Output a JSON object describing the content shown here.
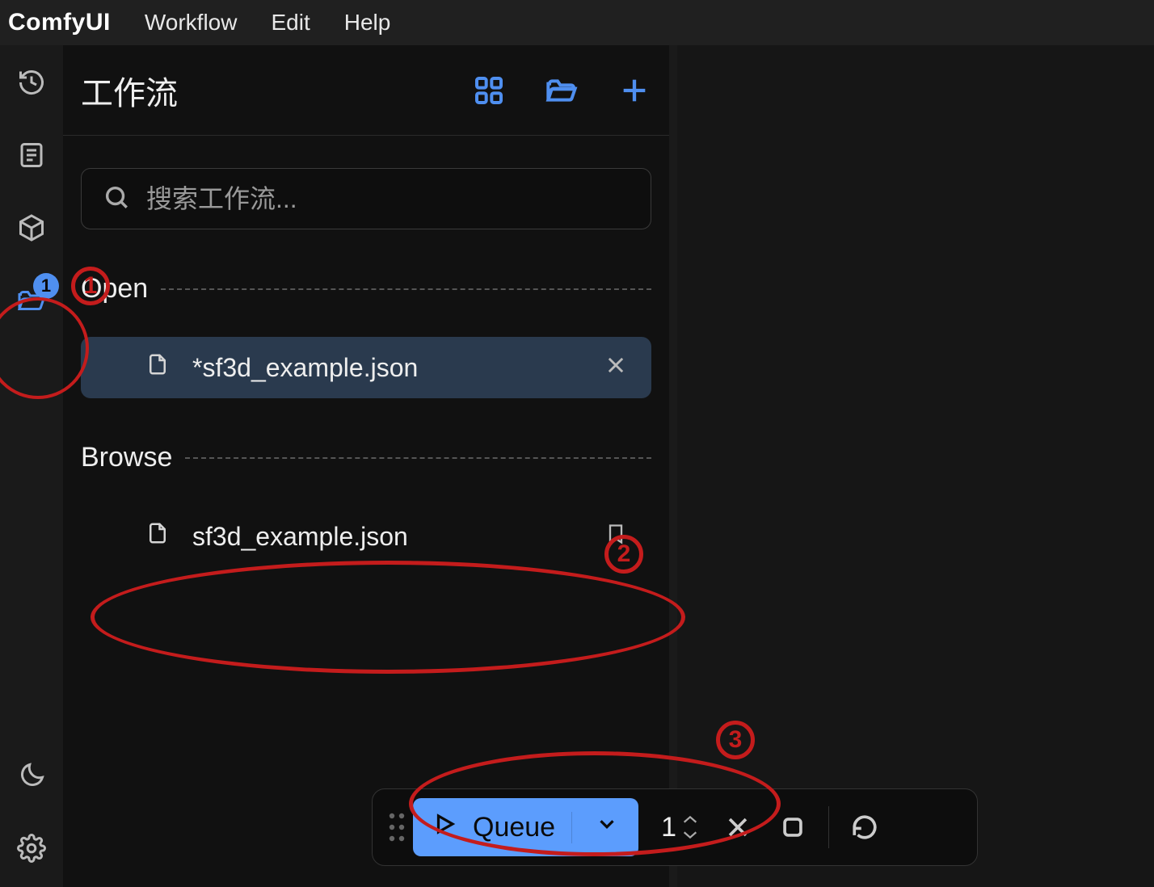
{
  "menubar": {
    "logo": "ComfyUI",
    "items": [
      "Workflow",
      "Edit",
      "Help"
    ]
  },
  "rail": {
    "folder_badge": "1"
  },
  "panel": {
    "title": "工作流",
    "search_placeholder": "搜索工作流...",
    "sections": {
      "open": {
        "label": "Open",
        "file": "*sf3d_example.json"
      },
      "browse": {
        "label": "Browse",
        "file": "sf3d_example.json"
      }
    }
  },
  "queuebar": {
    "queue_label": "Queue",
    "count": "1"
  },
  "annotations": {
    "n1": "1",
    "n2": "2",
    "n3": "3"
  }
}
